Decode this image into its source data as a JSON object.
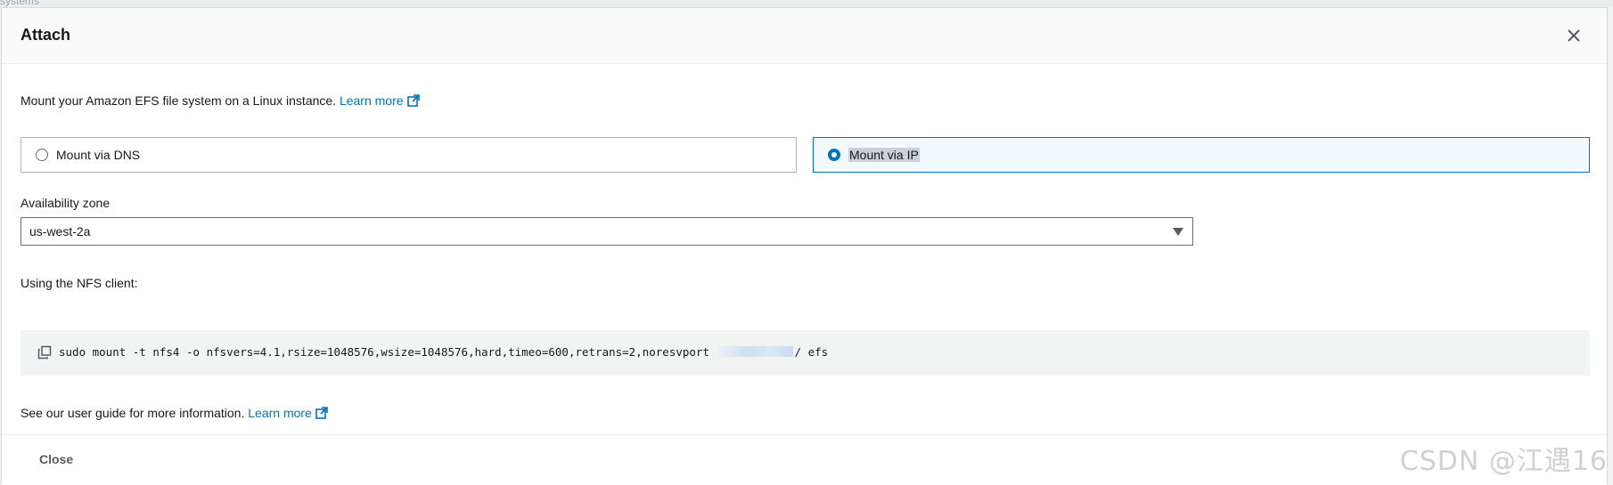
{
  "backdrop": {
    "partial_text": "systems"
  },
  "modal": {
    "title": "Attach",
    "intro_text": "Mount your Amazon EFS file system on a Linux instance.",
    "intro_link": "Learn more",
    "mount_options": [
      {
        "label": "Mount via DNS",
        "selected": false
      },
      {
        "label": "Mount via IP",
        "selected": true
      }
    ],
    "availability_zone": {
      "label": "Availability zone",
      "value": "us-west-2a"
    },
    "nfs_label": "Using the NFS client:",
    "command": {
      "prefix": "sudo mount -t nfs4 -o nfsvers=4.1,rsize=1048576,wsize=1048576,hard,timeo=600,retrans=2,noresvport",
      "suffix": "/ efs"
    },
    "guide_text": "See our user guide for more information.",
    "guide_link": "Learn more",
    "close_button": "Close"
  },
  "watermark": "CSDN @江遇16",
  "icons": {
    "close": "close-icon",
    "external_link": "external-link-icon",
    "copy": "copy-icon",
    "dropdown": "chevron-down-icon"
  },
  "colors": {
    "accent": "#0073bb",
    "selected_bg": "#f1faff",
    "text": "#16191f"
  }
}
